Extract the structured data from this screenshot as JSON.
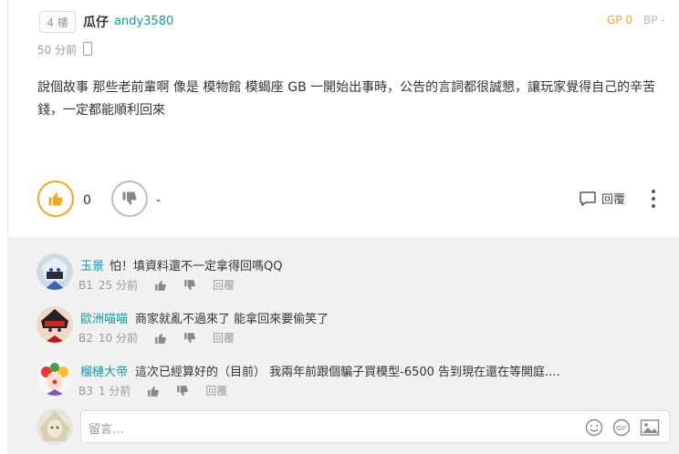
{
  "post": {
    "floor": "4 樓",
    "author_name": "瓜仔",
    "author_id": "andy3580",
    "gp": "GP 0",
    "bp": "BP -",
    "time": "50 分前",
    "content": "說個故事 那些老前輩啊 像是 模物館 模蝎座 GB 一開始出事時，公告的言詞都很誠懇，讓玩家覺得自己的辛苦錢，一定都能順利回來",
    "like_count": "0",
    "dislike_count": "-",
    "reply_label": "回覆",
    "accent_color": "#f5a623"
  },
  "comments": [
    {
      "name": "玉景",
      "text": "怕！填資料還不一定拿得回嗎QQ",
      "floor": "B1",
      "ago": "25 分前",
      "reply": "回覆"
    },
    {
      "name": "歐洲喵喵",
      "text": "商家就亂不過來了 能拿回來要偷笑了",
      "floor": "B2",
      "ago": "10 分前",
      "reply": "回覆"
    },
    {
      "name": "榴槤大帝",
      "text": "這次已經算好的（目前） 我兩年前跟個騙子買模型-6500 告到現在還在等開庭....",
      "floor": "B3",
      "ago": "1 分前",
      "reply": "回覆"
    }
  ],
  "reply_bar": {
    "placeholder": "留言…",
    "icons": [
      "emoji-icon",
      "gif-icon",
      "image-icon"
    ]
  }
}
